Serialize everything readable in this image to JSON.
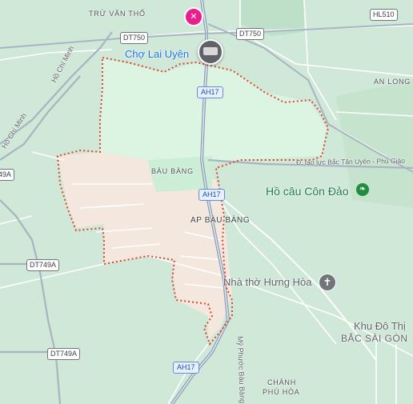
{
  "map": {
    "places": {
      "tru_van_tho": "TRỪ VĂN THỐ",
      "bau_bang": "BÀU BÀNG",
      "ap_bau_bang": "AP BÀU BÀNG",
      "an_long": "AN LONG",
      "chanh_phu_hoa_1": "CHÁNH",
      "chanh_phu_hoa_2": "PHÚ HÒA"
    },
    "pois": {
      "cho_lai_uyen": "Chợ Lai Uyên",
      "ho_cau": "Hồ câu Côn Đảo",
      "nha_tho": "Nhà thờ Hưng Hòa",
      "khu_do_thi_1": "Khu Đô Thị",
      "khu_do_thi_2": "BẮC SÀI GÒN"
    },
    "roads": {
      "ho_chi_minh_1": "Hồ Chí Minh",
      "ho_chi_minh_2": "Hồ Chí Minh",
      "tao_luc": "Đ. tạo lực Bắc Tân Uyên - Phú Giáo",
      "my_phuoc": "Mỹ Phước Bàu Bàng"
    },
    "shields": {
      "dt750_left": "DT750",
      "dt750_right": "DT750",
      "hl510": "HL510",
      "ah17_top": "AH17",
      "ah17_mid": "AH17",
      "ah17_bottom": "AH17",
      "dt749a_1": "DT749A",
      "dt749a_2": "DT749A",
      "dt749a_edge": "49A"
    },
    "colors": {
      "land": "#cfe8d7",
      "forest": "#d9f2e0",
      "industrial": "#f3e7de",
      "boundary": "#e0442f",
      "road": "#ffffff",
      "highway": "#a9b4c2"
    }
  }
}
